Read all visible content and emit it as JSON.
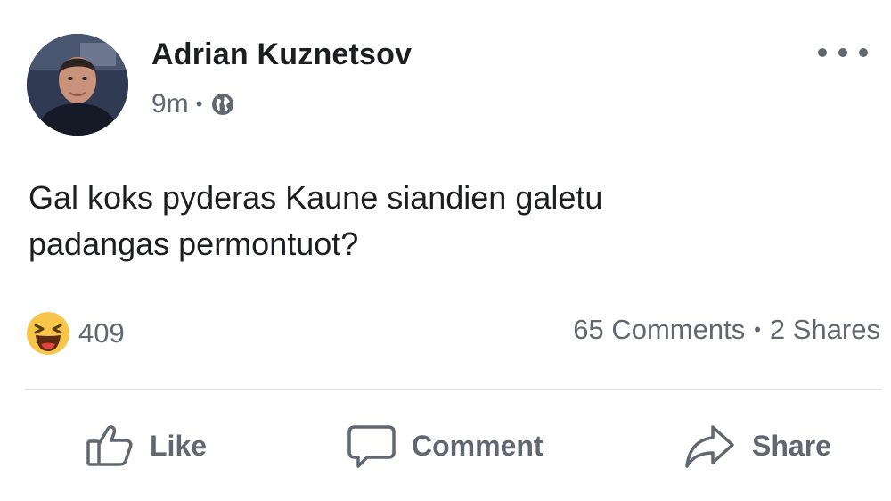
{
  "post": {
    "author": {
      "name": "Adrian Kuznetsov",
      "avatar_icon": "profile-photo"
    },
    "time": "9m",
    "privacy_icon": "globe-icon",
    "more_icon": "ellipsis-icon",
    "text_lines": [
      "Gal koks pyderas Kaune siandien galetu",
      "padangas permontuot?"
    ],
    "reactions": {
      "icon": "haha-icon",
      "count": "409"
    },
    "comments_label": "65 Comments",
    "shares_label": "2 Shares",
    "actions": {
      "like_label": "Like",
      "comment_label": "Comment",
      "share_label": "Share"
    }
  },
  "colors": {
    "text_primary": "#1c1e21",
    "text_secondary": "#606770",
    "divider": "#dadde1",
    "haha_yellow": "#f7c54a"
  }
}
